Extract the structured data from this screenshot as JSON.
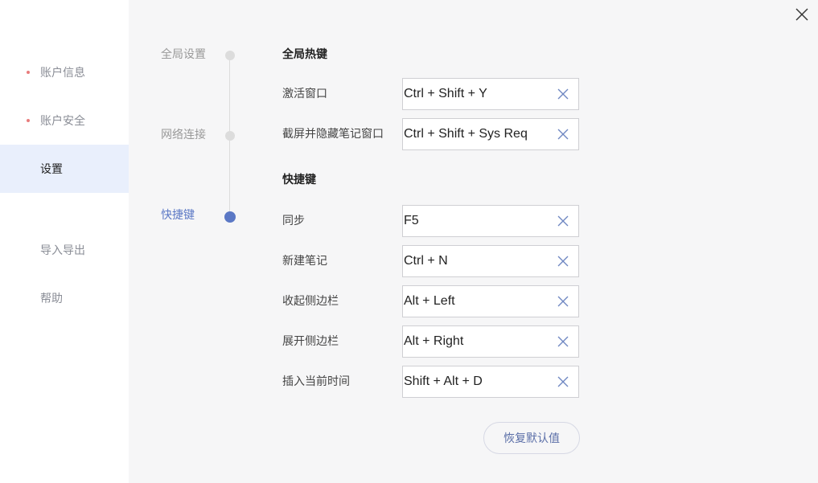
{
  "sidebar": {
    "items": [
      {
        "label": "账户信息"
      },
      {
        "label": "账户安全"
      },
      {
        "label": "设置"
      },
      {
        "label": "导入导出"
      },
      {
        "label": "帮助"
      }
    ]
  },
  "settings_nav": {
    "items": [
      {
        "label": "全局设置"
      },
      {
        "label": "网络连接"
      },
      {
        "label": "快捷键"
      }
    ]
  },
  "global_hotkeys": {
    "title": "全局热键",
    "rows": [
      {
        "label": "激活窗口",
        "value": "Ctrl + Shift + Y"
      },
      {
        "label": "截屏并隐藏笔记窗口",
        "value": "Ctrl + Shift + Sys Req"
      }
    ]
  },
  "shortcuts": {
    "title": "快捷键",
    "rows": [
      {
        "label": "同步",
        "value": "F5"
      },
      {
        "label": "新建笔记",
        "value": "Ctrl + N"
      },
      {
        "label": "收起侧边栏",
        "value": "Alt + Left"
      },
      {
        "label": "展开侧边栏",
        "value": "Alt + Right"
      },
      {
        "label": "插入当前时间",
        "value": "Shift + Alt + D"
      }
    ]
  },
  "actions": {
    "reset_label": "恢复默认值"
  },
  "icons": {
    "close": "close-icon",
    "clear": "clear-icon"
  },
  "colors": {
    "accent": "#5b78c5",
    "badge_dot": "#e87c7c",
    "active_bg": "#e9effc"
  }
}
